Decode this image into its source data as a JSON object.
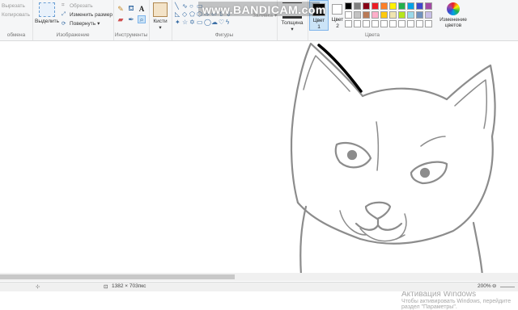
{
  "ribbon": {
    "clipboard": {
      "cut": "Вырезать",
      "copy": "Копировать",
      "group_label": "обмена"
    },
    "image": {
      "select": "Выделить",
      "crop": "Обрезать",
      "resize": "Изменить размер",
      "rotate": "Повернуть",
      "group_label": "Изображение"
    },
    "tools": {
      "group_label": "Инструменты"
    },
    "brushes": {
      "label": "Кисти"
    },
    "shapes": {
      "fill": "Заливка",
      "group_label": "Фигуры"
    },
    "size": {
      "label": "Толщина"
    },
    "colors": {
      "color1_label": "Цвет",
      "color1_num": "1",
      "color2_label": "Цвет",
      "color2_num": "2",
      "edit_colors": "Изменение цветов",
      "group_label": "Цвета",
      "color1_value": "#000000",
      "color2_value": "#ffffff",
      "palette_row1": [
        "#000000",
        "#7f7f7f",
        "#880015",
        "#ed1c24",
        "#ff7f27",
        "#fff200",
        "#22b14c",
        "#00a2e8",
        "#3f48cc",
        "#a349a4"
      ],
      "palette_row2": [
        "#ffffff",
        "#c3c3c3",
        "#b97a57",
        "#ffaec9",
        "#ffc90e",
        "#efe4b0",
        "#b5e61d",
        "#99d9ea",
        "#7092be",
        "#c8bfe7"
      ],
      "palette_row3": [
        "#ffffff",
        "#ffffff",
        "#ffffff",
        "#ffffff",
        "#ffffff",
        "#ffffff",
        "#ffffff",
        "#ffffff",
        "#ffffff",
        "#ffffff"
      ]
    }
  },
  "watermark": "www.BANDICAM.com",
  "activation": {
    "title": "Активация Windows",
    "line1": "Чтобы активировать Windows, перейдите",
    "line2": "раздел \"Параметры\"."
  },
  "status": {
    "dimensions": "1382 × 703пкс",
    "zoom": "200%"
  }
}
